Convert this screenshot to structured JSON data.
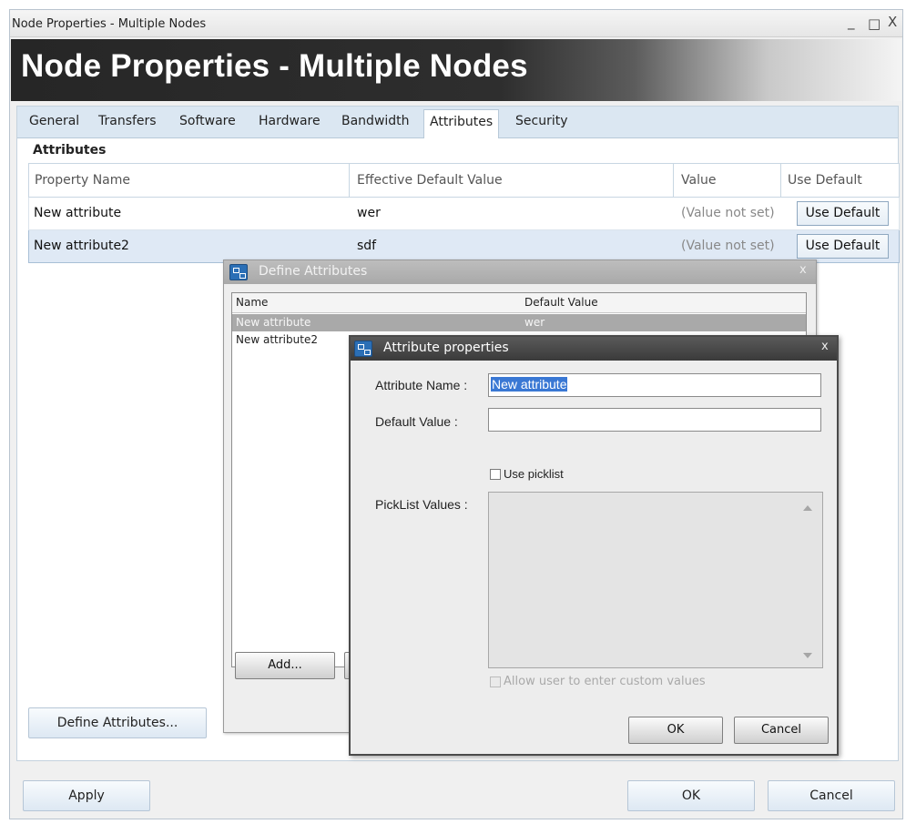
{
  "window": {
    "title": "Node Properties - Multiple Nodes",
    "banner_title": "Node Properties - Multiple Nodes",
    "controls": {
      "minimize": "_",
      "maximize": "□",
      "close": "X"
    }
  },
  "tabs": [
    "General",
    "Transfers",
    "Software",
    "Hardware",
    "Bandwidth",
    "Attributes",
    "Security"
  ],
  "active_tab": "Attributes",
  "section_label": "Attributes",
  "grid": {
    "columns": [
      "Property Name",
      "Effective Default Value",
      "Value",
      "Use Default"
    ],
    "rows": [
      {
        "name": "New attribute",
        "default": "wer",
        "value": "(Value not set)",
        "button": "Use Default"
      },
      {
        "name": "New attribute2",
        "default": "sdf",
        "value": "(Value not set)",
        "button": "Use Default",
        "selected": true
      }
    ]
  },
  "buttons": {
    "define_attributes": "Define Attributes...",
    "apply": "Apply",
    "ok": "OK",
    "cancel": "Cancel"
  },
  "define_dialog": {
    "title": "Define Attributes",
    "close": "x",
    "columns": [
      "Name",
      "Default Value"
    ],
    "rows": [
      {
        "name": "New attribute",
        "default": "wer",
        "selected": true
      },
      {
        "name": "New attribute2",
        "default": ""
      }
    ],
    "add_button": "Add..."
  },
  "props_dialog": {
    "title": "Attribute properties",
    "close": "x",
    "name_label": "Attribute Name :",
    "name_value": "New attribute",
    "default_label": "Default Value :",
    "default_value": "",
    "use_picklist": "Use picklist",
    "picklist_label": "PickList Values :",
    "allow_custom": "Allow user to enter custom values",
    "ok": "OK",
    "cancel": "Cancel"
  },
  "colors": {
    "banner_dark": "#262626",
    "tab_strip": "#dbe7f2",
    "selection_blue": "#3a78d4",
    "selected_row": "#dfe9f5"
  }
}
